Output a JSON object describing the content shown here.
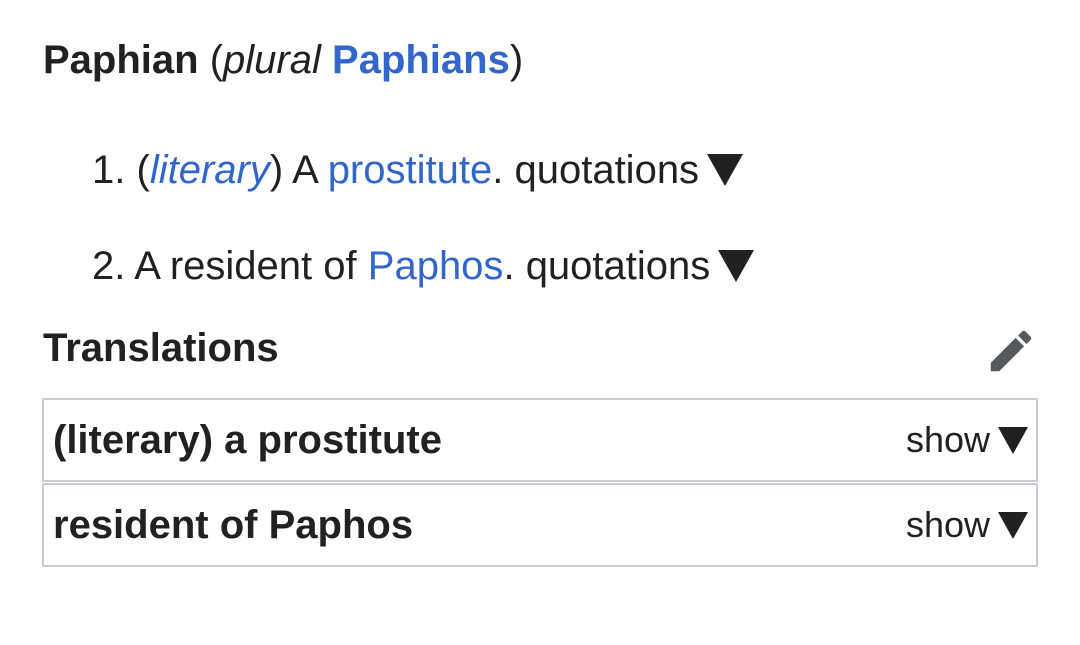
{
  "headword": {
    "word": "Paphian",
    "paren_open": "(",
    "plural_label": "plural",
    "plural_form": "Paphians",
    "paren_close": ")"
  },
  "senses": [
    {
      "number": "1.",
      "paren_open": "(",
      "label": "literary",
      "paren_close": ")",
      "text_before": "A",
      "link": "prostitute",
      "text_after": ".",
      "quotations": "quotations"
    },
    {
      "number": "2.",
      "text_before": "A resident of",
      "link": "Paphos",
      "text_after": ".",
      "quotations": "quotations"
    }
  ],
  "translations": {
    "heading": "Translations",
    "edit_icon": "pencil-icon",
    "boxes": [
      {
        "title": "(literary) a prostitute",
        "toggle": "show"
      },
      {
        "title": "resident of Paphos",
        "toggle": "show"
      }
    ]
  },
  "colors": {
    "link": "#3366cc",
    "text": "#202122",
    "border": "#c8ccd1",
    "icon": "#54595d"
  }
}
